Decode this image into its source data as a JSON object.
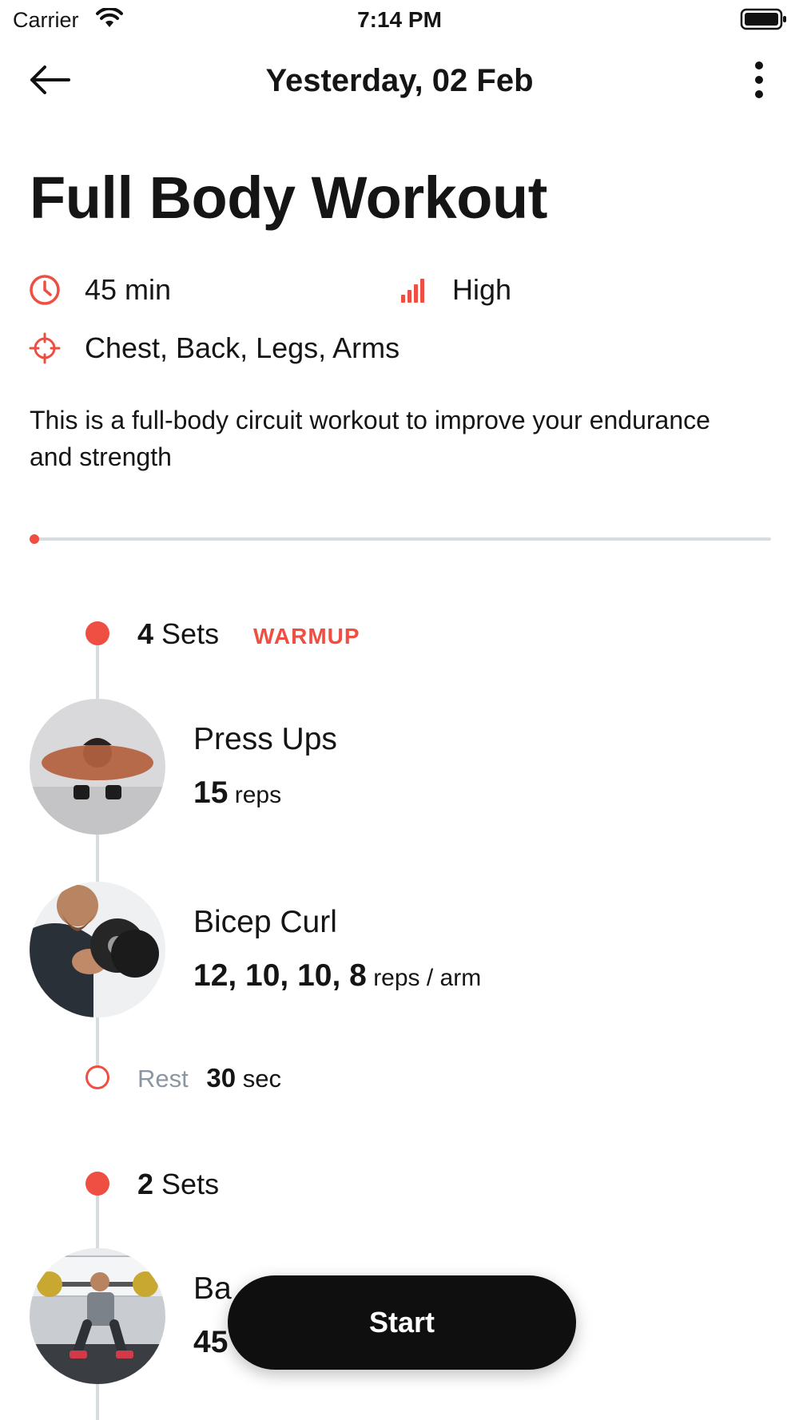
{
  "status_bar": {
    "carrier": "Carrier",
    "time": "7:14 PM"
  },
  "nav": {
    "title": "Yesterday, 02 Feb"
  },
  "workout": {
    "title": "Full Body Workout",
    "duration": "45 min",
    "intensity": "High",
    "targets": "Chest, Back, Legs, Arms",
    "description": "This is a full-body circuit workout to improve your endurance and strength",
    "progress": 0.0
  },
  "blocks": [
    {
      "sets_count": "4",
      "sets_label": "Sets",
      "tag": "WARMUP",
      "exercises": [
        {
          "name": "Press Ups",
          "reps_values": "15",
          "reps_unit": "reps"
        },
        {
          "name": "Bicep Curl",
          "reps_values": "12, 10, 10, 8",
          "reps_unit": "reps / arm"
        }
      ],
      "rest": {
        "label": "Rest",
        "value": "30",
        "unit": "sec"
      }
    },
    {
      "sets_count": "2",
      "sets_label": "Sets",
      "exercises": [
        {
          "name": "Ba",
          "reps_values": "45"
        }
      ]
    }
  ],
  "actions": {
    "start_label": "Start"
  },
  "colors": {
    "accent": "#ef4e42",
    "line": "#d6dde1",
    "button": "#0f0f0f"
  }
}
